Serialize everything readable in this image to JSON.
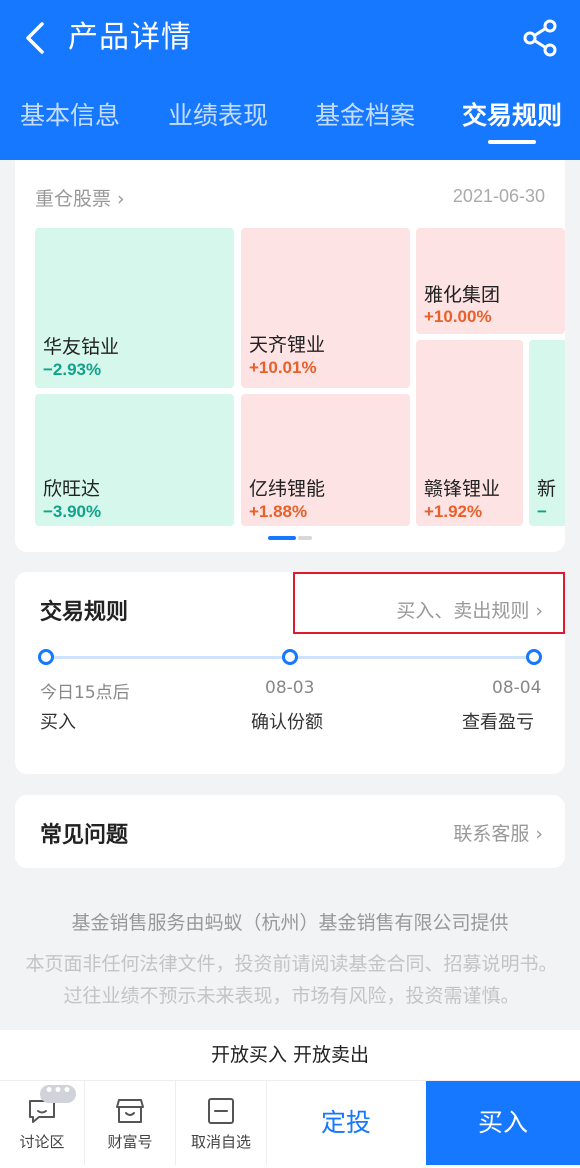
{
  "header": {
    "title": "产品详情",
    "tabs": [
      "基本信息",
      "业绩表现",
      "基金档案",
      "交易规则"
    ],
    "active_tab": "交易规则"
  },
  "holdings": {
    "label": "重仓股票 ›",
    "date": "2021-06-30",
    "stocks": [
      {
        "name": "华友钴业",
        "change": "−2.93%"
      },
      {
        "name": "天齐锂业",
        "change": "+10.01%"
      },
      {
        "name": "雅化集团",
        "change": "+10.00%"
      },
      {
        "name": "欣旺达",
        "change": "−3.90%"
      },
      {
        "name": "亿纬锂能",
        "change": "+1.88%"
      },
      {
        "name": "赣锋锂业",
        "change": "+1.92%"
      },
      {
        "name": "新",
        "change": "−"
      }
    ]
  },
  "trade_rules": {
    "title": "交易规则",
    "link": "买入、卖出规则 ›",
    "steps": [
      {
        "time": "今日15点后",
        "action": "买入"
      },
      {
        "time": "08-03",
        "action": "确认份额"
      },
      {
        "time": "08-04",
        "action": "查看盈亏"
      }
    ]
  },
  "faq": {
    "title": "常见问题",
    "link": "联系客服 ›"
  },
  "disclaimer": {
    "line1": "基金销售服务由蚂蚁（杭州）基金销售有限公司提供",
    "line2": "本页面非任何法律文件，投资前请阅读基金合同、招募说明书。过往业绩不预示未来表现，市场有风险，投资需谨慎。"
  },
  "status": "开放买入 开放卖出",
  "bottom_bar": {
    "badge": "•••",
    "discuss": "讨论区",
    "wealth": "财富号",
    "unfavorite": "取消自选",
    "dingtou": "定投",
    "buy": "买入"
  },
  "colors": {
    "primary": "#1677ff",
    "up": "#e8602a",
    "down": "#11a38a",
    "highlight_box": "#e0192c"
  }
}
